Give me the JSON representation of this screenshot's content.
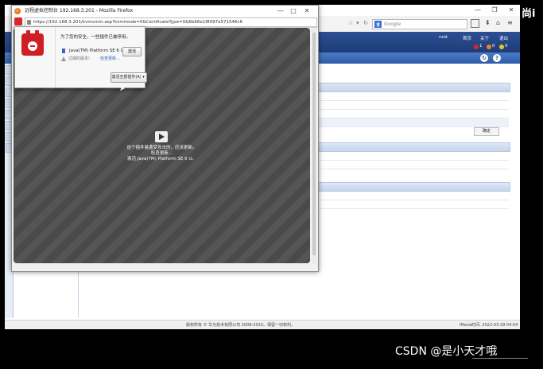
{
  "popup": {
    "title": "远程虚拟控制台 192.168.3.201 - Mozilla Firefox",
    "url": "https://192.168.3.201/kvmvmm.asp?kvmmode=0&CertificateType=0&6b66e1f8097e571546c6",
    "window_controls": [
      "—",
      "□",
      "✕"
    ]
  },
  "notification": {
    "message": "为了您的安全，一些插件已被停用。",
    "plugin_name": "Java(TM) Platform SE 6 U",
    "activate_label": "激活",
    "outdated_label": "过期的版本!",
    "check_update_label": "检查更新...",
    "activate_all_label": "激活全部插件(A)",
    "dropdown_arrow": "▾"
  },
  "plugin_placeholder": {
    "line1": "这个插件易遭受攻击的，应该更新。",
    "line2": "检查更新...",
    "line3": "激活 Java(TM) Platform SE 6 U。"
  },
  "main_window": {
    "window_controls": [
      "—",
      "❐",
      "✕"
    ],
    "search_placeholder": "Google",
    "search_engine_letter": "g",
    "user": "root",
    "header_links": [
      "首页",
      "关于",
      "退出"
    ],
    "alert_counts": [
      "1",
      "0",
      "0"
    ],
    "ok_button": "确定",
    "status_left": "版权所有 © 华为技术有限公司 2008-2015。保留一切权利。",
    "status_right": "iMana时间:   2022-03-29 04:04"
  },
  "side_text": "尚i",
  "watermark": "CSDN @是小天才哦"
}
